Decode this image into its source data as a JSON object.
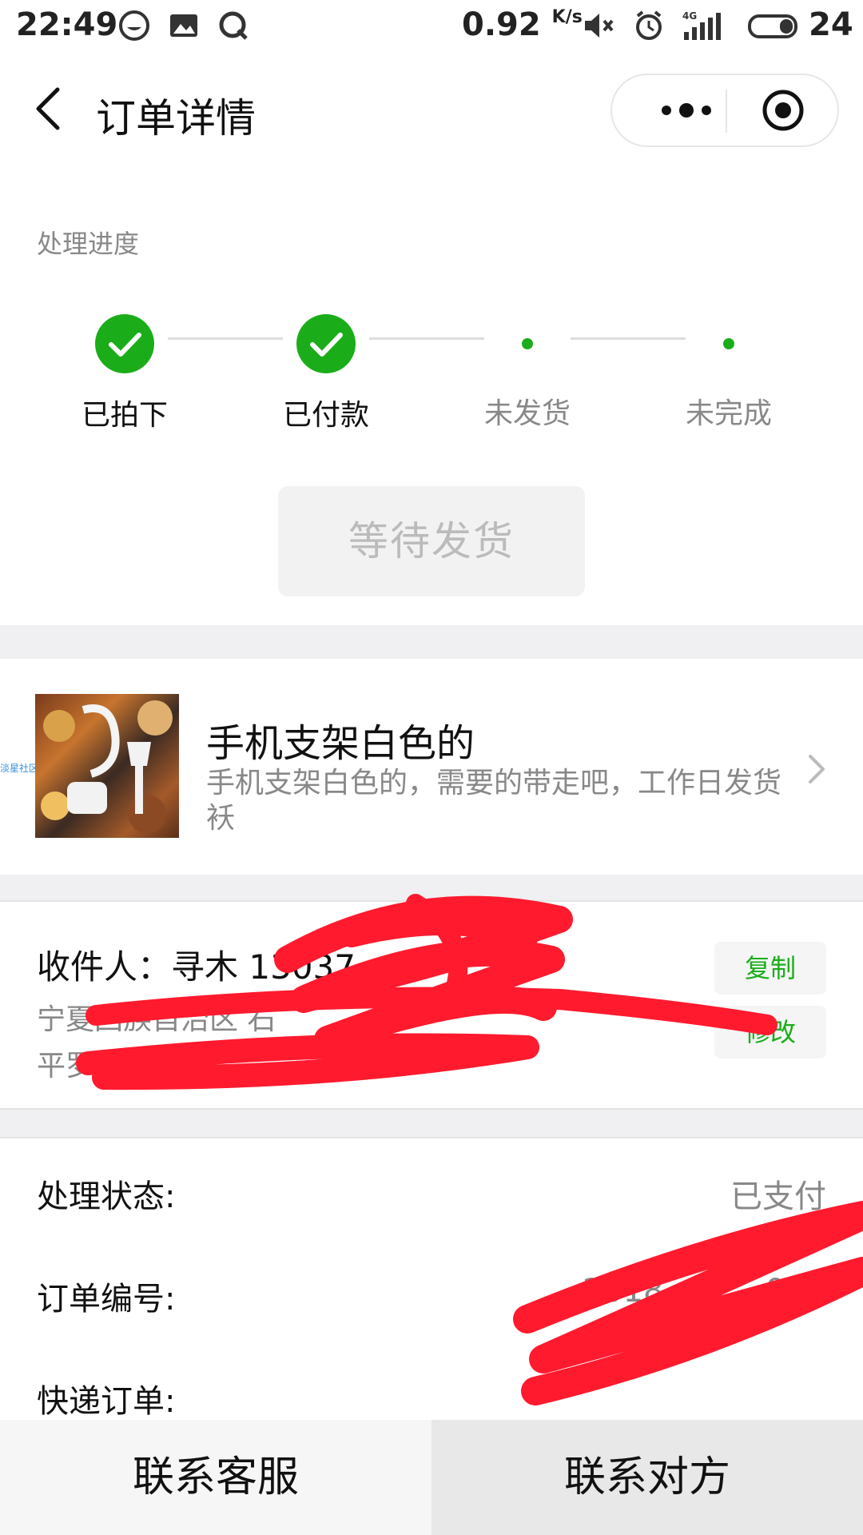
{
  "status_bar": {
    "time": "22:49",
    "speed": "0.92",
    "speed_unit": "K/s",
    "battery": "24",
    "network": "4G"
  },
  "nav": {
    "title": "订单详情"
  },
  "progress": {
    "label": "处理进度",
    "steps": [
      {
        "label": "已拍下",
        "state": "done"
      },
      {
        "label": "已付款",
        "state": "done"
      },
      {
        "label": "未发货",
        "state": "pending"
      },
      {
        "label": "未完成",
        "state": "pending"
      }
    ],
    "status_button": "等待发货"
  },
  "product": {
    "title": "手机支架白色的",
    "description": "手机支架白色的，需要的带走吧，工作日发货袄",
    "watermark": "淡星社区"
  },
  "address": {
    "name": "收件人：寻木 13037",
    "line1": "宁夏回族自治区 石",
    "line2": "平罗县",
    "copy_label": "复制",
    "edit_label": "修改"
  },
  "info": {
    "status_label": "处理状态:",
    "status_value": "已支付",
    "order_label": "订单编号:",
    "order_value": "2018          000",
    "express_label": "快递订单:"
  },
  "bottom": {
    "service_label": "联系客服",
    "contact_label": "联系对方"
  },
  "colors": {
    "accent": "#1aad19",
    "muted": "#888888",
    "redaction": "#ff1a2e"
  }
}
